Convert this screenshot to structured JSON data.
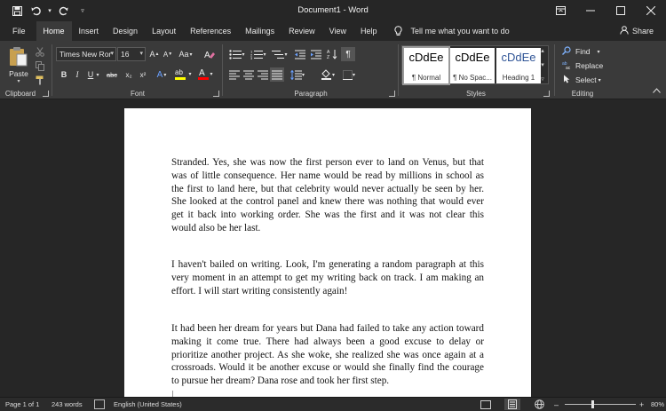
{
  "window": {
    "title": "Document1  -  Word"
  },
  "qat": {
    "save_icon": "save-icon",
    "undo_icon": "undo-icon",
    "redo_icon": "redo-icon",
    "customize_icon": "customize-qat-icon"
  },
  "tabs": [
    "File",
    "Home",
    "Insert",
    "Design",
    "Layout",
    "References",
    "Mailings",
    "Review",
    "View",
    "Help"
  ],
  "active_tab": "Home",
  "tellme": {
    "text": "Tell me what you want to do"
  },
  "share": {
    "label": "Share"
  },
  "ribbon": {
    "clipboard": {
      "label": "Clipboard",
      "paste_label": "Paste"
    },
    "font": {
      "label": "Font",
      "font_name": "Times New Ror",
      "font_size": "16",
      "case_label": "Aa",
      "bold": "B",
      "italic": "I",
      "underline": "U",
      "strike": "abc",
      "subscript": "x₂",
      "superscript": "x²",
      "font_color_glyph": "A",
      "highlight_color": "#ffff00",
      "font_color": "#ff0000"
    },
    "paragraph": {
      "label": "Paragraph"
    },
    "styles": {
      "label": "Styles",
      "items": [
        {
          "sample": "cDdEe",
          "name": "¶ Normal"
        },
        {
          "sample": "cDdEe",
          "name": "¶ No Spac..."
        },
        {
          "sample": "cDdEe",
          "name": "Heading 1"
        }
      ]
    },
    "editing": {
      "label": "Editing",
      "find": "Find",
      "replace": "Replace",
      "select": "Select"
    }
  },
  "document": {
    "paragraphs": [
      "Stranded. Yes, she was now the first person ever to land on Venus, but that was of little consequence. Her name would be read by millions in school as the first to land here, but that celebrity would never actually be seen by her. She looked at the control panel and knew there was nothing that would ever get it back into working order. She was the first and it was not clear this would also be her last.",
      "I haven't bailed on writing. Look, I'm generating a random paragraph at this very moment in an attempt to get my writing back on track. I am making an effort. I will start writing consistently again!",
      "It had been her dream for years but Dana had failed to take any action toward making it come true. There had always been a good excuse to delay or prioritize another project. As she woke, she realized she was once again at a crossroads. Would it be another excuse or would she finally find the courage to pursue her dream? Dana rose and took her first step."
    ]
  },
  "statusbar": {
    "page": "Page 1 of 1",
    "words": "243 words",
    "language": "English (United States)",
    "zoom": "80%",
    "zoom_minus": "–",
    "zoom_plus": "+"
  }
}
